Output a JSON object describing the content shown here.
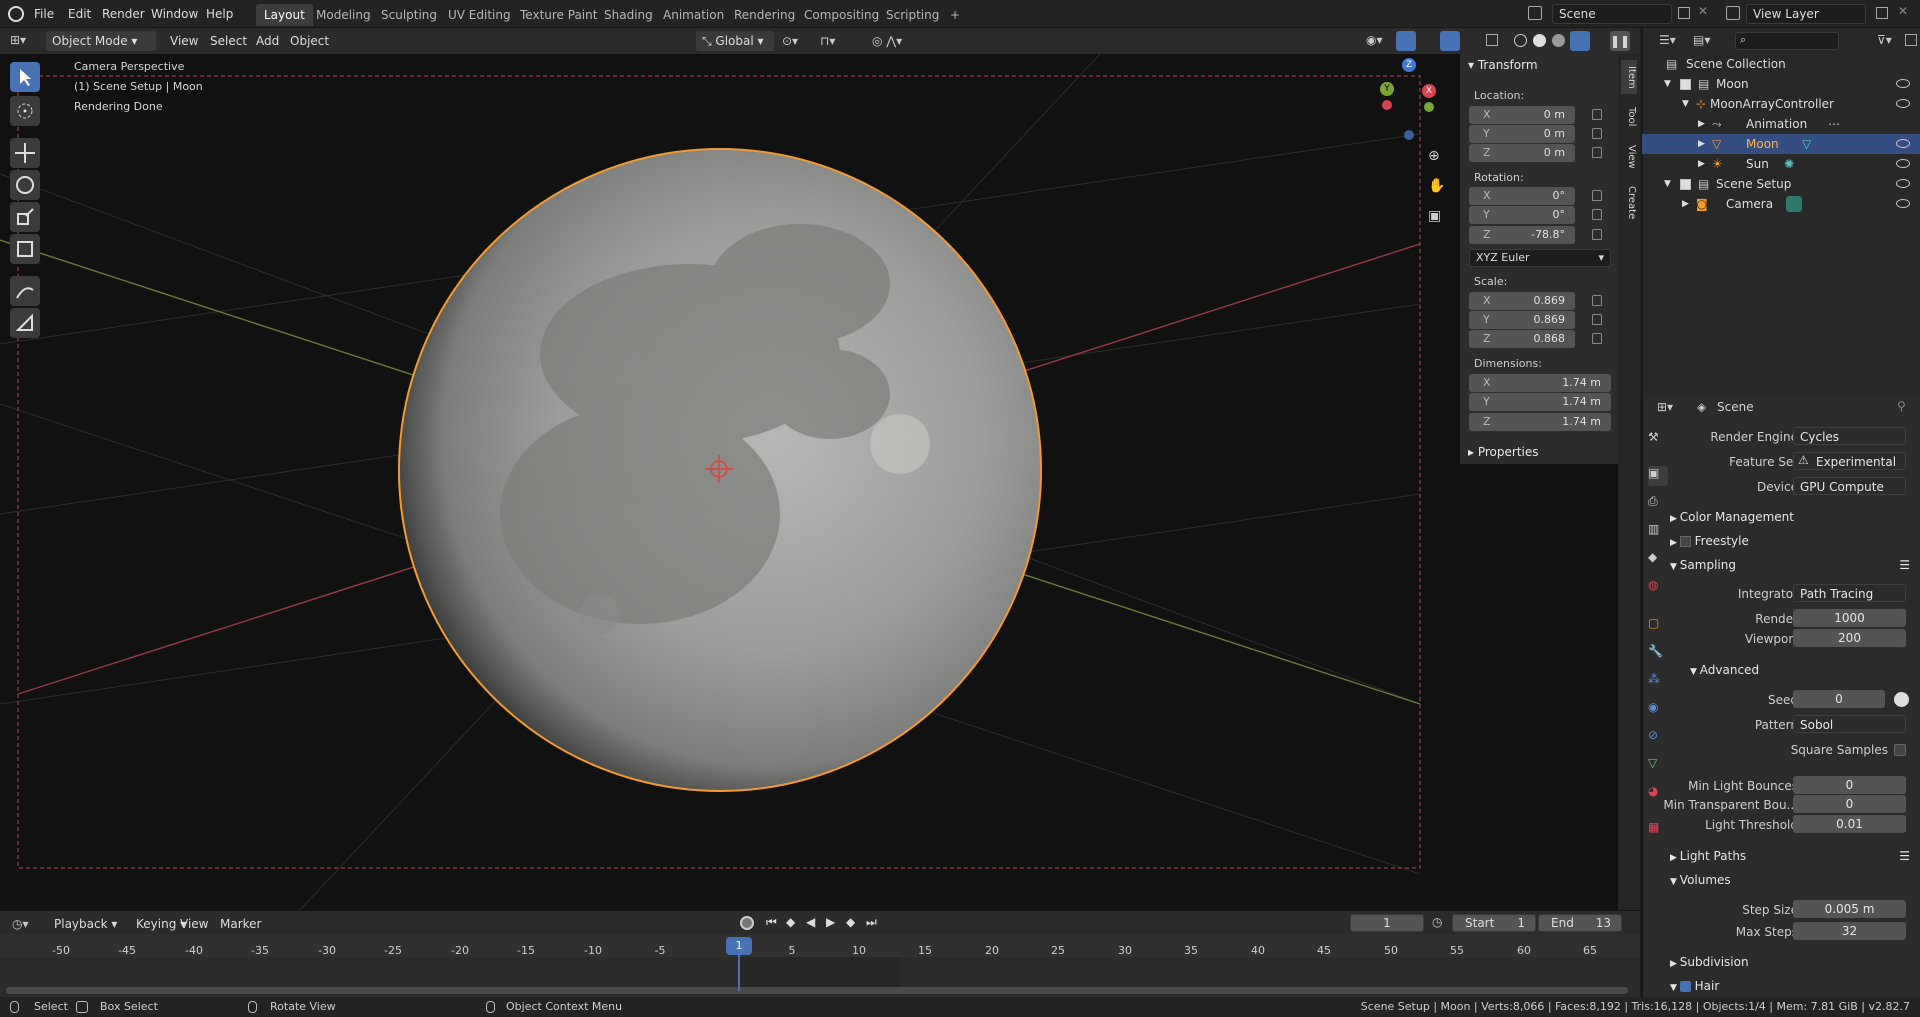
{
  "topbar": {
    "menus": [
      "File",
      "Edit",
      "Render",
      "Window",
      "Help"
    ],
    "workspaces": [
      "Layout",
      "Modeling",
      "Sculpting",
      "UV Editing",
      "Texture Paint",
      "Shading",
      "Animation",
      "Rendering",
      "Compositing",
      "Scripting"
    ],
    "add_tab": "+",
    "scene": "Scene",
    "view_layer": "View Layer"
  },
  "viewport_header": {
    "mode": "Object Mode",
    "menus": [
      "View",
      "Select",
      "Add",
      "Object"
    ],
    "orientation": "Global"
  },
  "viewport": {
    "overlay_lines": [
      "Camera Perspective",
      "(1) Scene Setup | Moon",
      "Rendering Done"
    ],
    "gizmo": {
      "z": "Z",
      "x": "X",
      "y": "Y"
    },
    "accent_color": "#f59a2e"
  },
  "npanel": {
    "section": "Transform",
    "location_label": "Location:",
    "location": [
      {
        "axis": "X",
        "value": "0 m"
      },
      {
        "axis": "Y",
        "value": "0 m"
      },
      {
        "axis": "Z",
        "value": "0 m"
      }
    ],
    "rotation_label": "Rotation:",
    "rotation": [
      {
        "axis": "X",
        "value": "0°"
      },
      {
        "axis": "Y",
        "value": "0°"
      },
      {
        "axis": "Z",
        "value": "-78.8°"
      }
    ],
    "rotation_mode": "XYZ Euler",
    "scale_label": "Scale:",
    "scale": [
      {
        "axis": "X",
        "value": "0.869"
      },
      {
        "axis": "Y",
        "value": "0.869"
      },
      {
        "axis": "Z",
        "value": "0.868"
      }
    ],
    "dimensions_label": "Dimensions:",
    "dimensions": [
      {
        "axis": "X",
        "value": "1.74 m"
      },
      {
        "axis": "Y",
        "value": "1.74 m"
      },
      {
        "axis": "Z",
        "value": "1.74 m"
      }
    ],
    "properties": "Properties",
    "tabs": [
      "Item",
      "Tool",
      "View",
      "Create"
    ]
  },
  "outliner": {
    "search_placeholder": "",
    "rows": [
      {
        "label": "Scene Collection"
      },
      {
        "label": "Moon"
      },
      {
        "label": "MoonArrayController"
      },
      {
        "label": "Animation"
      },
      {
        "label": "Moon"
      },
      {
        "label": "Sun"
      },
      {
        "label": "Scene Setup"
      },
      {
        "label": "Camera"
      }
    ]
  },
  "properties": {
    "context": "Scene",
    "render_engine_label": "Render Engine",
    "render_engine": "Cycles",
    "feature_set_label": "Feature Set",
    "feature_set": "Experimental",
    "device_label": "Device",
    "device": "GPU Compute",
    "color_management": "Color Management",
    "freestyle": "Freestyle",
    "sampling": "Sampling",
    "integrator_label": "Integrator",
    "integrator": "Path Tracing",
    "render_label": "Render",
    "render_samples": "1000",
    "viewport_label": "Viewport",
    "viewport_samples": "200",
    "advanced": "Advanced",
    "seed_label": "Seed",
    "seed": "0",
    "pattern_label": "Pattern",
    "pattern": "Sobol",
    "square_samples": "Square Samples",
    "min_light_bounces_label": "Min Light Bounces",
    "min_light_bounces": "0",
    "min_transparent_label": "Min Transparent Bou...",
    "min_transparent": "0",
    "light_threshold_label": "Light Threshold",
    "light_threshold": "0.01",
    "light_paths": "Light Paths",
    "volumes": "Volumes",
    "step_size_label": "Step Size",
    "step_size": "0.005 m",
    "max_steps_label": "Max Steps",
    "max_steps": "32",
    "subdivision": "Subdivision",
    "hair": "Hair"
  },
  "timeline": {
    "menus": [
      "Playback",
      "Keying",
      "View",
      "Marker"
    ],
    "current_frame": "1",
    "start_label": "Start",
    "start": "1",
    "end_label": "End",
    "end": "13",
    "ticks": [
      "-50",
      "-45",
      "-40",
      "-35",
      "-30",
      "-25",
      "-20",
      "-15",
      "-10",
      "-5",
      "0",
      "5",
      "10",
      "15",
      "20",
      "25",
      "30",
      "35",
      "40",
      "45",
      "50",
      "55",
      "60",
      "65"
    ]
  },
  "statusbar": {
    "select": "Select",
    "box_select": "Box Select",
    "rotate_view": "Rotate View",
    "context_menu": "Object Context Menu",
    "stats": "Scene Setup | Moon | Verts:8,066 | Faces:8,192 | Tris:16,128 | Objects:1/4 | Mem: 7.81 GiB | v2.82.7"
  }
}
